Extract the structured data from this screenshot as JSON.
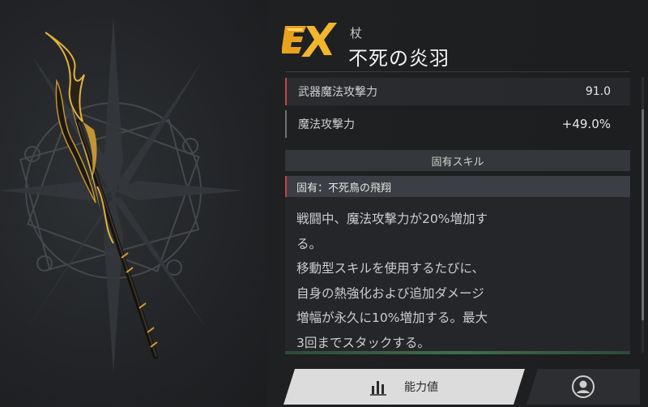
{
  "header": {
    "rarity": "EX",
    "type": "杖",
    "name": "不死の炎羽"
  },
  "stats": [
    {
      "label": "武器魔法攻撃力",
      "value": "91.0"
    },
    {
      "label": "魔法攻撃力",
      "value": "+49.0%"
    }
  ],
  "skill": {
    "section_title": "固有スキル",
    "name": "固有：不死鳥の飛翔",
    "description_lines": [
      "戦闘中、魔法攻撃力が20%増加す",
      "る。",
      "移動型スキルを使用するたびに、",
      "自身の熱強化および追加ダメージ",
      "増幅が永久に10%増加する。最大",
      "3回までスタックする。"
    ]
  },
  "tabs": {
    "stats_label": "能力値"
  },
  "colors": {
    "accent_red": "#c5443c",
    "ex_gold": "#e8a21c",
    "active_tab": "#dcdcdc"
  },
  "icons": {
    "stats_tab": "bar-chart-icon",
    "profile_tab": "person-circle-icon"
  }
}
